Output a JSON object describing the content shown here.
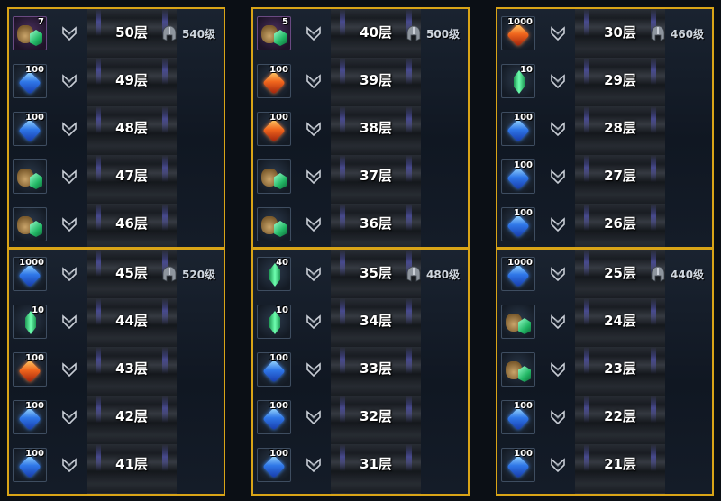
{
  "accent_color": "#d9a417",
  "panels": [
    {
      "level_label": "540级",
      "rows": [
        {
          "floor": "50层",
          "item": "bag-crystal",
          "qty": "7",
          "frame": "purple"
        },
        {
          "floor": "49层",
          "item": "blue-gem",
          "qty": "100",
          "frame": "normal"
        },
        {
          "floor": "48层",
          "item": "blue-gem",
          "qty": "100",
          "frame": "normal"
        },
        {
          "floor": "47层",
          "item": "bag-crystal",
          "qty": "",
          "frame": "normal"
        },
        {
          "floor": "46层",
          "item": "bag-crystal",
          "qty": "",
          "frame": "normal"
        }
      ]
    },
    {
      "level_label": "500级",
      "rows": [
        {
          "floor": "40层",
          "item": "bag-crystal",
          "qty": "5",
          "frame": "purple"
        },
        {
          "floor": "39层",
          "item": "red-gem",
          "qty": "100",
          "frame": "normal"
        },
        {
          "floor": "38层",
          "item": "red-gem",
          "qty": "100",
          "frame": "normal"
        },
        {
          "floor": "37层",
          "item": "bag-crystal",
          "qty": "",
          "frame": "normal"
        },
        {
          "floor": "36层",
          "item": "bag-crystal",
          "qty": "",
          "frame": "normal"
        }
      ]
    },
    {
      "level_label": "460级",
      "rows": [
        {
          "floor": "30层",
          "item": "red-gem",
          "qty": "1000",
          "frame": "normal"
        },
        {
          "floor": "29层",
          "item": "green-crystal",
          "qty": "10",
          "frame": "normal"
        },
        {
          "floor": "28层",
          "item": "blue-gem",
          "qty": "100",
          "frame": "normal"
        },
        {
          "floor": "27层",
          "item": "blue-gem",
          "qty": "100",
          "frame": "normal"
        },
        {
          "floor": "26层",
          "item": "blue-gem",
          "qty": "100",
          "frame": "normal"
        }
      ]
    },
    {
      "level_label": "520级",
      "rows": [
        {
          "floor": "45层",
          "item": "blue-gem",
          "qty": "1000",
          "frame": "normal"
        },
        {
          "floor": "44层",
          "item": "green-crystal",
          "qty": "10",
          "frame": "normal"
        },
        {
          "floor": "43层",
          "item": "red-gem",
          "qty": "100",
          "frame": "normal"
        },
        {
          "floor": "42层",
          "item": "blue-gem",
          "qty": "100",
          "frame": "normal"
        },
        {
          "floor": "41层",
          "item": "blue-gem",
          "qty": "100",
          "frame": "normal"
        }
      ]
    },
    {
      "level_label": "480级",
      "rows": [
        {
          "floor": "35层",
          "item": "green-crystal",
          "qty": "40",
          "frame": "normal"
        },
        {
          "floor": "34层",
          "item": "green-crystal",
          "qty": "10",
          "frame": "normal"
        },
        {
          "floor": "33层",
          "item": "blue-gem",
          "qty": "100",
          "frame": "normal"
        },
        {
          "floor": "32层",
          "item": "blue-gem",
          "qty": "100",
          "frame": "normal"
        },
        {
          "floor": "31层",
          "item": "blue-gem",
          "qty": "100",
          "frame": "normal"
        }
      ]
    },
    {
      "level_label": "440级",
      "rows": [
        {
          "floor": "25层",
          "item": "blue-gem",
          "qty": "1000",
          "frame": "normal"
        },
        {
          "floor": "24层",
          "item": "bag-crystal",
          "qty": "",
          "frame": "normal"
        },
        {
          "floor": "23层",
          "item": "bag-crystal",
          "qty": "",
          "frame": "normal"
        },
        {
          "floor": "22层",
          "item": "blue-gem",
          "qty": "100",
          "frame": "normal"
        },
        {
          "floor": "21层",
          "item": "blue-gem",
          "qty": "100",
          "frame": "normal"
        }
      ]
    }
  ]
}
